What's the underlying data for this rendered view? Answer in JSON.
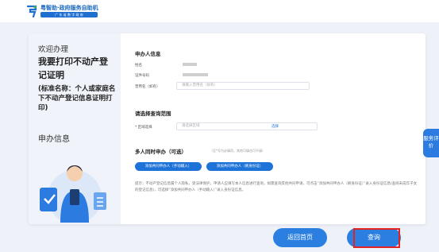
{
  "header": {
    "brand_title": "粤智助·政府服务自助机",
    "brand_subtitle": "广 东 省 数 字 政 府"
  },
  "left": {
    "welcome": "欢迎办理",
    "title": "我要打印不动产登记证明",
    "subtitle": "(标准名称：个人或家庭名下不动产登记信息证明打印)",
    "apply_info": "申办信息"
  },
  "applicant": {
    "section_title": "申办人信息",
    "name_label": "姓名",
    "id_label": "证件号码",
    "alias_label": "曾用名（如有）",
    "alias_placeholder": "请输入曾用名（如有）"
  },
  "scope": {
    "section_title": "请选择查询范围",
    "region_label": "* 区域选择",
    "region_placeholder": "请选择区域",
    "select_link": "选择"
  },
  "multi": {
    "section_title": "多人同时申办（可选）",
    "hint": "（至*号为必填项，其他可填也可不填）",
    "manual_button": "添加共同申办人（手动输入）",
    "card_button": "添加共同申办人（刷身份证）"
  },
  "notice": "提示：不动产登记信息属个人隐私，受法律保护。申请人应填写本人信息进行查询，如需查询其他共同申请，可点击“添加共同申办人（刷身份证）”录入身份证信息(查阅未成年子女的登记信息)，可选择“添加共同申办人（手动输入）”录入身份证信息。",
  "side": {
    "service_eval": "服务评价"
  },
  "footer": {
    "home_button": "返回首页",
    "query_button": "查询"
  }
}
